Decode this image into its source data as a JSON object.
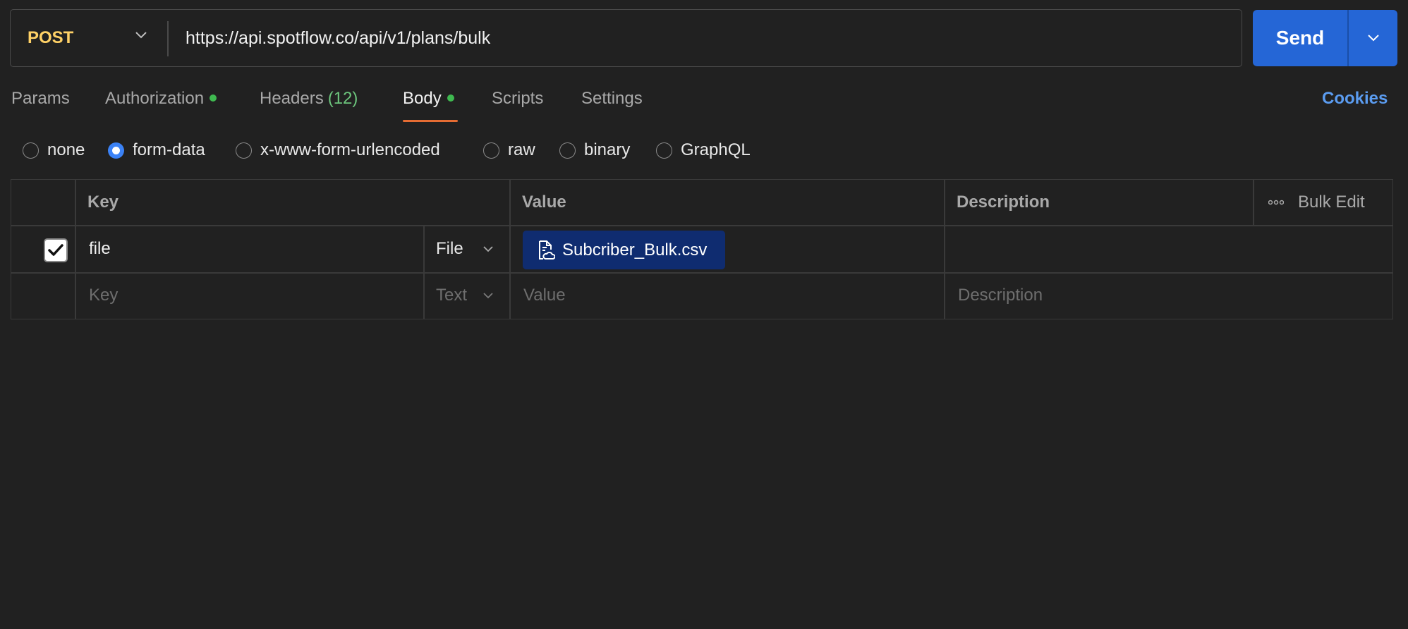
{
  "request": {
    "method": "POST",
    "url": "https://api.spotflow.co/api/v1/plans/bulk",
    "send_label": "Send"
  },
  "tabs": [
    {
      "label": "Params"
    },
    {
      "label": "Authorization",
      "dot": true
    },
    {
      "label": "Headers",
      "count": "(12)"
    },
    {
      "label": "Body",
      "dot": true,
      "active": true
    },
    {
      "label": "Scripts"
    },
    {
      "label": "Settings"
    }
  ],
  "cookies_label": "Cookies",
  "body_types": [
    {
      "label": "none"
    },
    {
      "label": "form-data",
      "selected": true
    },
    {
      "label": "x-www-form-urlencoded"
    },
    {
      "label": "raw"
    },
    {
      "label": "binary"
    },
    {
      "label": "GraphQL"
    }
  ],
  "table": {
    "headers": {
      "key": "Key",
      "value": "Value",
      "description": "Description",
      "bulk_edit": "Bulk Edit"
    },
    "rows": [
      {
        "checked": true,
        "key": "file",
        "type": "File",
        "value": "Subcriber_Bulk.csv",
        "description": ""
      }
    ],
    "new_row": {
      "key_placeholder": "Key",
      "type": "Text",
      "value_placeholder": "Value",
      "description_placeholder": "Description"
    }
  },
  "colors": {
    "method": "#ffd166",
    "send": "#2566d6",
    "tab_underline": "#e56c33",
    "status_dot": "#3fb950",
    "link": "#5b9cf0",
    "file_chip": "#0f2c70"
  }
}
